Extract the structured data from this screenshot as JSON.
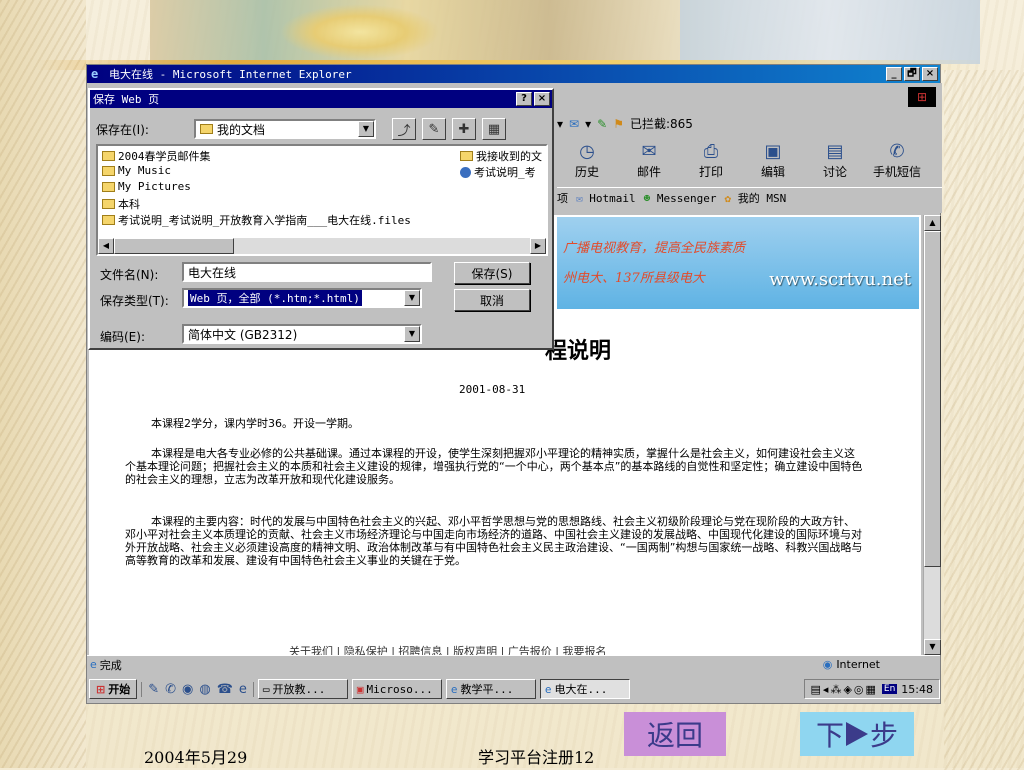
{
  "window": {
    "title": "电大在线 - Microsoft Internet Explorer",
    "controls": [
      "_",
      "🗗",
      "×"
    ]
  },
  "ie_toolbar": {
    "address_status": "已拦截:865",
    "buttons": [
      {
        "label": "历史",
        "icon": "history-icon"
      },
      {
        "label": "邮件",
        "icon": "mail-icon"
      },
      {
        "label": "打印",
        "icon": "print-icon"
      },
      {
        "label": "编辑",
        "icon": "edit-icon"
      },
      {
        "label": "讨论",
        "icon": "discuss-icon"
      },
      {
        "label": "手机短信",
        "icon": "sms-icon"
      }
    ],
    "links": [
      "项",
      "Hotmail",
      "Messenger",
      "我的 MSN"
    ]
  },
  "save_dialog": {
    "title": "保存 Web 页",
    "help_btn": "?",
    "close_btn": "×",
    "save_in_label": "保存在(I):",
    "save_in_value": "我的文档",
    "files": [
      "2004春学员邮件集",
      "My Music",
      "My Pictures",
      "本科",
      "考试说明_考试说明_开放教育入学指南___电大在线.files",
      "我接收到的文",
      "考试说明_考"
    ],
    "filename_label": "文件名(N):",
    "filename_value": "电大在线",
    "filetype_label": "保存类型(T):",
    "filetype_value": "Web 页，全部 (*.htm;*.html)",
    "encoding_label": "编码(E):",
    "encoding_value": "简体中文 (GB2312)",
    "save_button": "保存(S)",
    "cancel_button": "取消"
  },
  "page": {
    "banner_line1": "广播电视教育，提高全民族素质",
    "banner_line2": "州电大、137所县级电大",
    "banner_url": "www.scrtvu.net",
    "heading": "程说明",
    "date": "2001-08-31",
    "para1": "本课程2学分，课内学时36。开设一学期。",
    "para2": "本课程是电大各专业必修的公共基础课。通过本课程的开设，使学生深刻把握邓小平理论的精神实质，掌握什么是社会主义，如何建设社会主义这个基本理论问题；把握社会主义的本质和社会主义建设的规律，增强执行党的“一个中心，两个基本点”的基本路线的自觉性和坚定性；确立建设中国特色的社会主义的理想，立志为改革开放和现代化建设服务。",
    "para3": "本课程的主要内容：时代的发展与中国特色社会主义的兴起、邓小平哲学思想与党的思想路线、社会主义初级阶段理论与党在现阶段的大政方针、邓小平对社会主义本质理论的贡献、社会主义市场经济理论与中国走向市场经济的道路、中国社会主义建设的发展战略、中国现代化建设的国际环境与对外开放战略、社会主义必须建设高度的精神文明、政治体制改革与有中国特色社会主义民主政治建设、“一国两制”构想与国家统一战略、科教兴国战略与高等教育的改革和发展、建设有中国特色社会主义事业的关键在于党。",
    "footer_links": "关于我们 | 隐私保护 | 招聘信息 | 版权声明 | 广告报价 | 我要报名"
  },
  "statusbar": {
    "status": "完成",
    "zone": "Internet"
  },
  "taskbar": {
    "start": "开始",
    "tasks": [
      "开放教...",
      "Microso...",
      "教学平...",
      "电大在..."
    ],
    "lang": "En",
    "time": "15:48"
  },
  "slide": {
    "date": "2004年5月29",
    "page_title": "学习平台注册12",
    "back_label": "返回",
    "next_label_prefix": "下",
    "next_label_suffix": "步"
  },
  "colors": {
    "title_blue": "#000080",
    "back_button": "#c98fd8",
    "next_button": "#8fd6f0"
  }
}
